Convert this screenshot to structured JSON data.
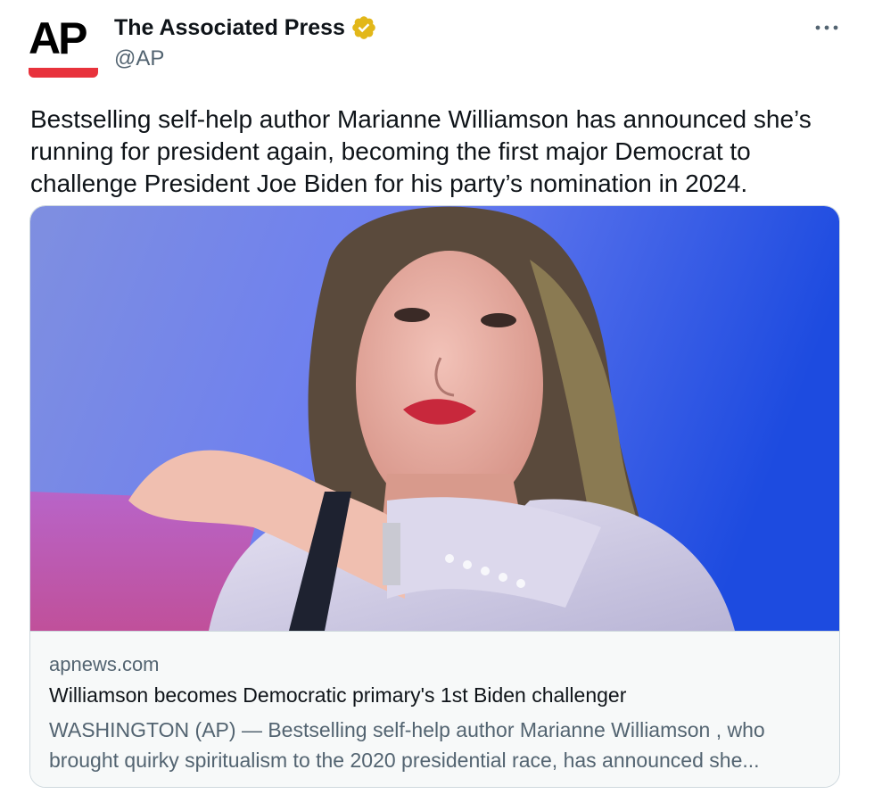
{
  "author": {
    "name": "The Associated Press",
    "handle": "@AP",
    "avatar_text": "AP",
    "verified": true,
    "verified_color": "#e2b719"
  },
  "tweet": {
    "text": "Bestselling self-help author Marianne Williamson has announced she’s\nrunning for president again, becoming the first major Democrat to\nchallenge President Joe Biden for his party’s nomination in 2024."
  },
  "card": {
    "image_icon": "photo-of-speaker-with-microphone",
    "domain": "apnews.com",
    "title": "Williamson becomes Democratic primary's 1st Biden challenger",
    "description": "WASHINGTON (AP) — Bestselling self-help author Marianne Williamson , who\nbrought quirky spiritualism to the 2020 presidential race, has announced she..."
  },
  "menu_icon": "more-options-icon",
  "colors": {
    "brand_red": "#e8323c",
    "text_primary": "#0f1419",
    "text_secondary": "#536471",
    "card_border": "#cfd9de",
    "card_bg": "#f7f9f9"
  }
}
